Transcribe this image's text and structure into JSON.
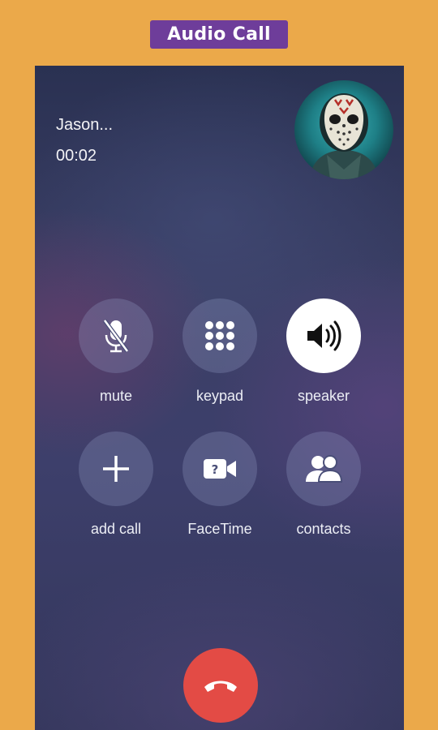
{
  "header": {
    "badge_label": "Audio Call"
  },
  "call": {
    "caller_name": "Jason...",
    "elapsed": "00:02"
  },
  "controls": [
    {
      "id": "mute",
      "label": "mute",
      "icon": "mic-off-icon",
      "active": false
    },
    {
      "id": "keypad",
      "label": "keypad",
      "icon": "keypad-icon",
      "active": false
    },
    {
      "id": "speaker",
      "label": "speaker",
      "icon": "speaker-icon",
      "active": true
    },
    {
      "id": "add_call",
      "label": "add call",
      "icon": "plus-icon",
      "active": false
    },
    {
      "id": "facetime",
      "label": "FaceTime",
      "icon": "video-camera-icon",
      "active": false
    },
    {
      "id": "contacts",
      "label": "contacts",
      "icon": "contacts-icon",
      "active": false
    }
  ],
  "end_call": {
    "icon": "hang-up-icon",
    "color": "#e34b45"
  },
  "colors": {
    "frame_background": "#eba94a",
    "badge_background": "#6e3d9a",
    "end_call": "#e34b45"
  }
}
